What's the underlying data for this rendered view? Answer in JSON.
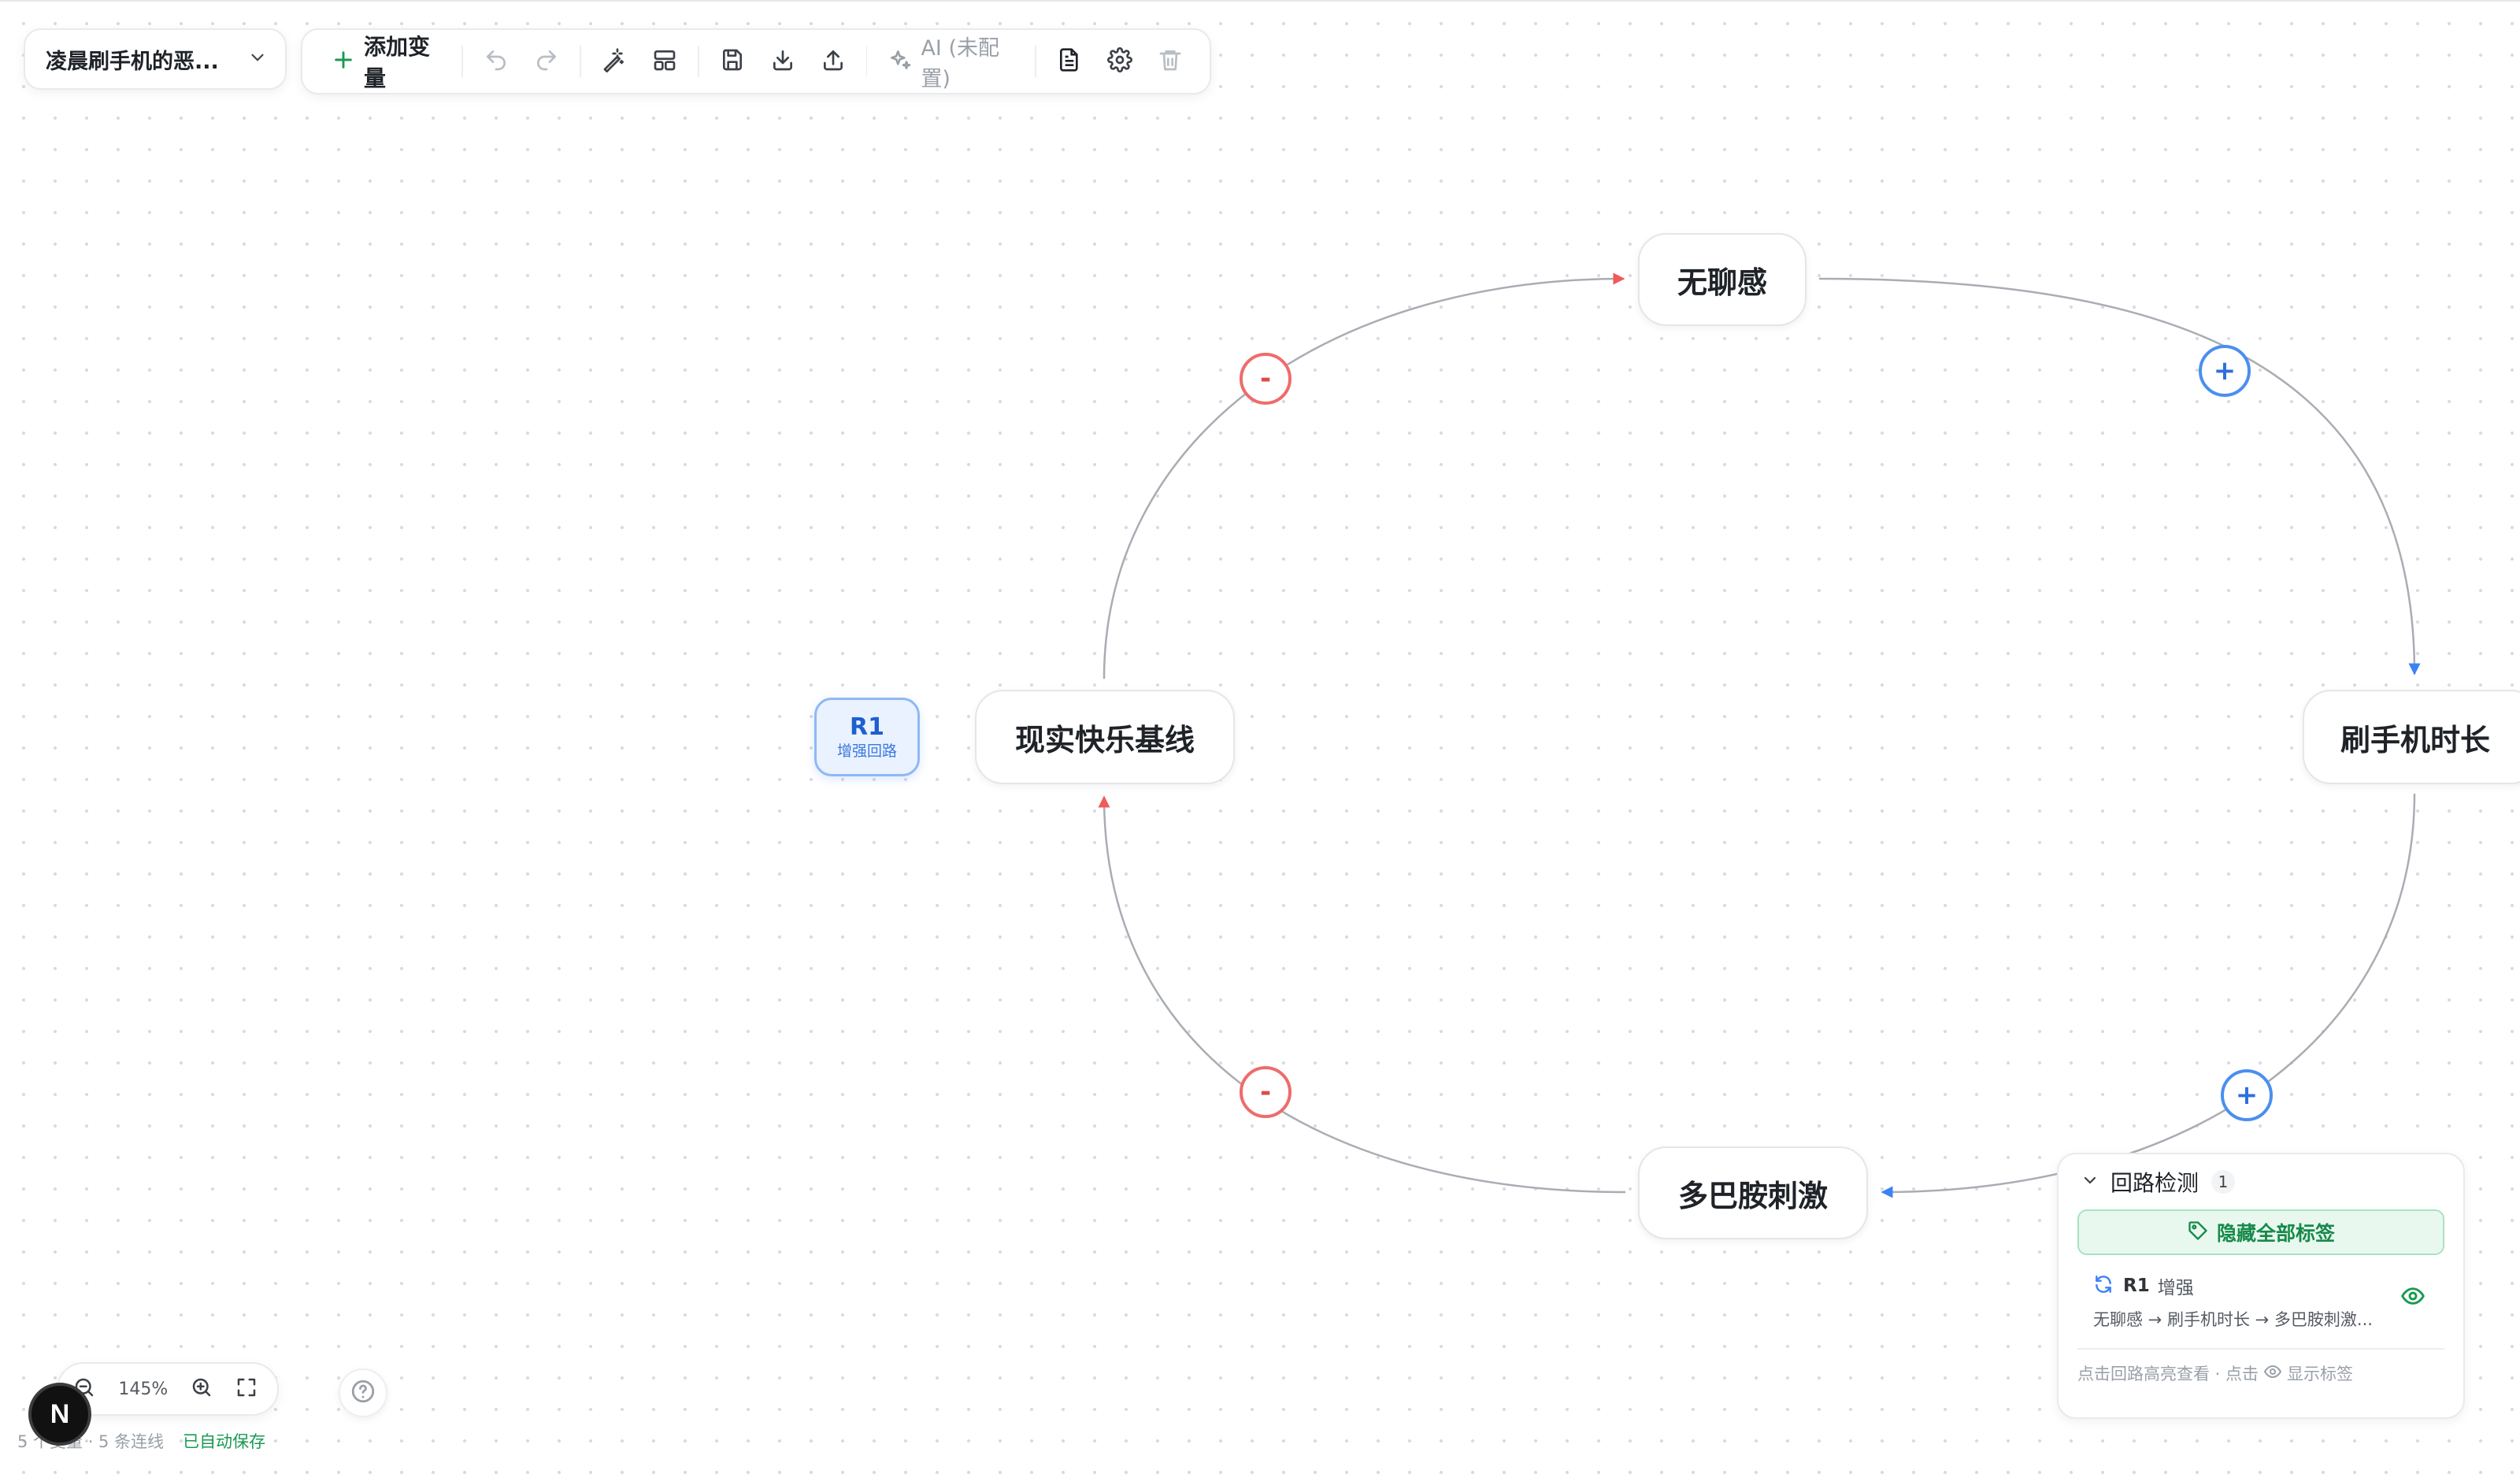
{
  "document": {
    "title": "凌晨刷手机的恶..."
  },
  "toolbar": {
    "add_variable_label": "添加变量",
    "ai_label": "AI (未配置)"
  },
  "nodes": {
    "boredom": "无聊感",
    "phone_time": "刷手机时长",
    "dopamine": "多巴胺刺激",
    "baseline": "现实快乐基线"
  },
  "loop_badge": {
    "code": "R1",
    "subtitle": "增强回路"
  },
  "polarities": {
    "neg": "-",
    "pos": "+"
  },
  "loop_panel": {
    "title": "回路检测",
    "count": "1",
    "hide_labels_button": "隐藏全部标签",
    "loops": [
      {
        "code": "R1",
        "type": "增强",
        "path": "无聊感 → 刷手机时长 → 多巴胺刺激..."
      }
    ],
    "footer_prefix": "点击回路高亮查看 · 点击",
    "footer_suffix": "显示标签"
  },
  "zoom": {
    "level": "145%"
  },
  "status": {
    "stats": "5 个变量 · 5 条连线",
    "saved": "已自动保存"
  },
  "n_badge": "N",
  "colors": {
    "negative": "#ef5a5a",
    "positive": "#3b82f6",
    "edge": "#a9adb3",
    "saved": "#1a9a52",
    "badge_bg": "#eaf2ff"
  }
}
